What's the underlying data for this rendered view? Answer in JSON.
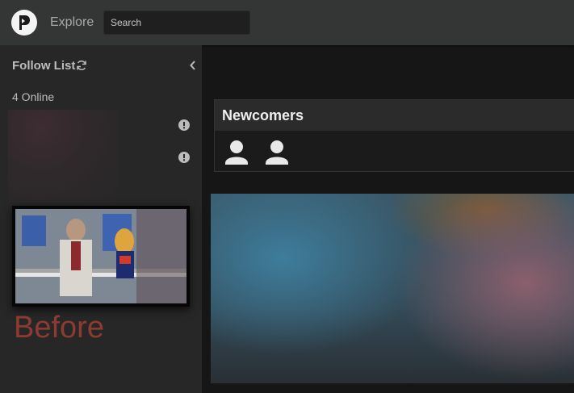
{
  "topbar": {
    "nav_explore": "Explore",
    "search_placeholder": "Search"
  },
  "sidebar": {
    "title": "Follow List",
    "online_count": "4 Online",
    "overlay_text": "Before"
  },
  "main": {
    "newcomers_title": "Newcomers"
  },
  "colors": {
    "topbar": "#343535",
    "sidebar": "#272727",
    "background": "#171616",
    "overlay_text": "#8c3b33"
  }
}
